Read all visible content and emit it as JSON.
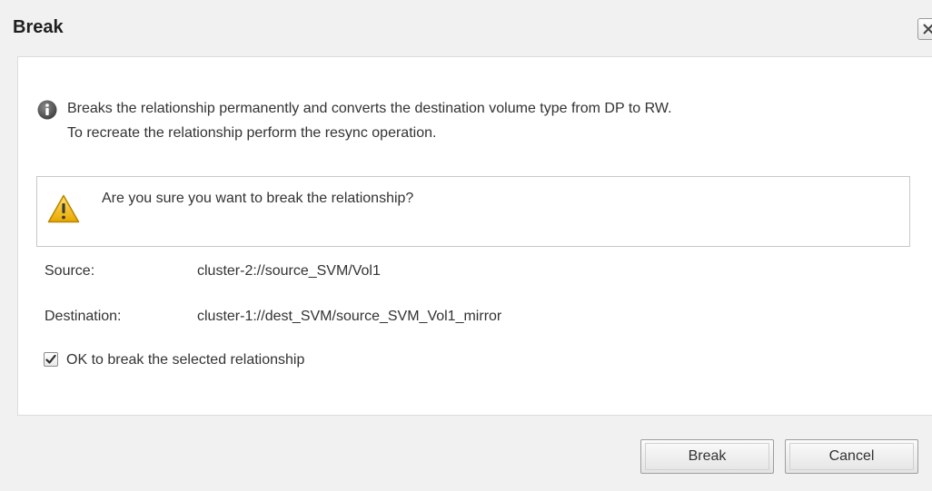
{
  "dialog": {
    "title": "Break",
    "close_icon": "close-icon"
  },
  "info": {
    "icon": "info-icon",
    "line1": "Breaks the relationship permanently and converts the destination volume type from DP to RW.",
    "line2": "To recreate the relationship perform the resync operation."
  },
  "warning": {
    "icon": "warning-icon",
    "text": "Are you sure you want to break the relationship?"
  },
  "details": {
    "source_label": "Source:",
    "source_value": "cluster-2://source_SVM/Vol1",
    "destination_label": "Destination:",
    "destination_value": "cluster-1://dest_SVM/source_SVM_Vol1_mirror"
  },
  "confirm": {
    "label": "OK to break the selected relationship",
    "checked": true
  },
  "buttons": {
    "break_label": "Break",
    "cancel_label": "Cancel"
  },
  "colors": {
    "info_blue": "#4a4a4a",
    "warning_yellow": "#f2b705",
    "panel_bg": "#f1f1f1"
  }
}
